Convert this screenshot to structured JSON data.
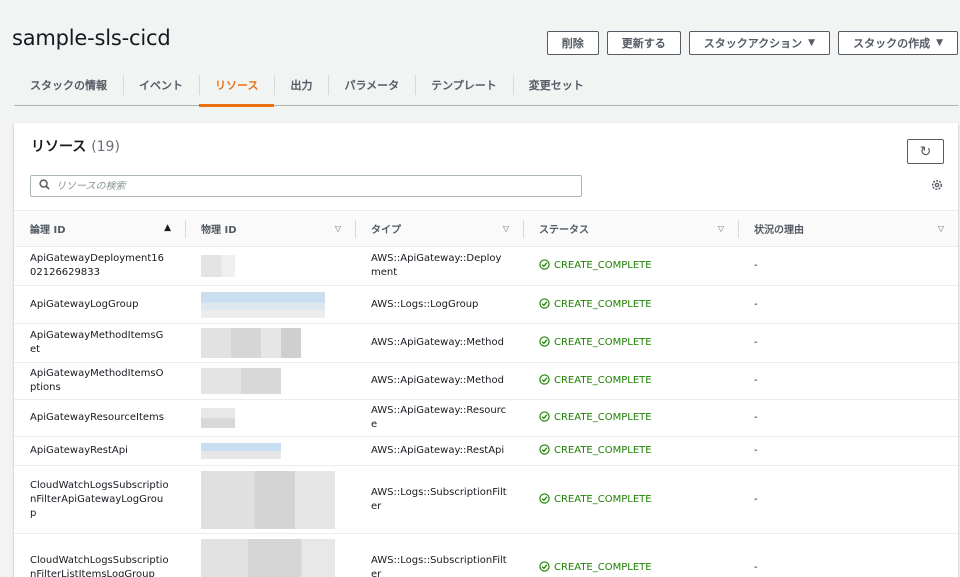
{
  "page": {
    "title": "sample-sls-cicd"
  },
  "actions": {
    "delete": "削除",
    "update": "更新する",
    "stack_actions": "スタックアクション",
    "create_stack": "スタックの作成"
  },
  "tabs": [
    "スタックの情報",
    "イベント",
    "リソース",
    "出力",
    "パラメータ",
    "テンプレート",
    "変更セット"
  ],
  "panel": {
    "title": "リソース",
    "count": "(19)",
    "search_placeholder": "リソースの検索"
  },
  "columns": [
    "論理 ID",
    "物理 ID",
    "タイプ",
    "ステータス",
    "状況の理由"
  ],
  "rows": [
    {
      "logical_id": "ApiGatewayDeployment1602126629833",
      "type": "AWS::ApiGateway::Deployment",
      "status": "CREATE_COMPLETE",
      "reason": "-"
    },
    {
      "logical_id": "ApiGatewayLogGroup",
      "type": "AWS::Logs::LogGroup",
      "status": "CREATE_COMPLETE",
      "reason": "-"
    },
    {
      "logical_id": "ApiGatewayMethodItemsGet",
      "type": "AWS::ApiGateway::Method",
      "status": "CREATE_COMPLETE",
      "reason": "-"
    },
    {
      "logical_id": "ApiGatewayMethodItemsOptions",
      "type": "AWS::ApiGateway::Method",
      "status": "CREATE_COMPLETE",
      "reason": "-"
    },
    {
      "logical_id": "ApiGatewayResourceItems",
      "type": "AWS::ApiGateway::Resource",
      "status": "CREATE_COMPLETE",
      "reason": "-"
    },
    {
      "logical_id": "ApiGatewayRestApi",
      "type": "AWS::ApiGateway::RestApi",
      "status": "CREATE_COMPLETE",
      "reason": "-"
    },
    {
      "logical_id": "CloudWatchLogsSubscriptionFilterApiGatewayLogGroup",
      "type": "AWS::Logs::SubscriptionFilter",
      "status": "CREATE_COMPLETE",
      "reason": "-"
    },
    {
      "logical_id": "CloudWatchLogsSubscriptionFilterListItemsLogGroup",
      "type": "AWS::Logs::SubscriptionFilter",
      "status": "CREATE_COMPLETE",
      "reason": "-"
    }
  ]
}
